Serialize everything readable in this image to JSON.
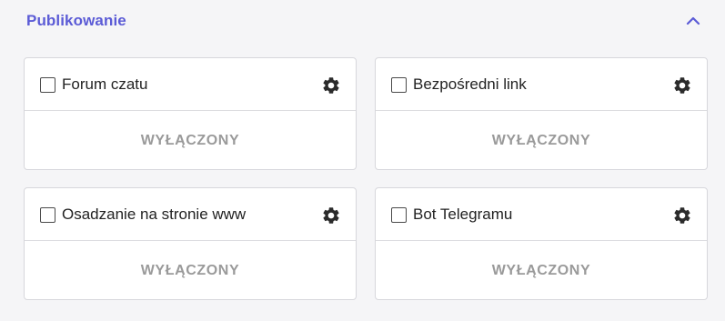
{
  "section": {
    "title": "Publikowanie",
    "collapse_icon": "chevron-up-icon",
    "accent_color": "#5b5bd6"
  },
  "cards": [
    {
      "label": "Forum czatu",
      "status": "WYŁĄCZONY",
      "checked": false,
      "icon": "gear-icon"
    },
    {
      "label": "Bezpośredni link",
      "status": "WYŁĄCZONY",
      "checked": false,
      "icon": "gear-icon"
    },
    {
      "label": "Osadzanie na stronie www",
      "status": "WYŁĄCZONY",
      "checked": false,
      "icon": "gear-icon"
    },
    {
      "label": "Bot Telegramu",
      "status": "WYŁĄCZONY",
      "checked": false,
      "icon": "gear-icon"
    }
  ]
}
